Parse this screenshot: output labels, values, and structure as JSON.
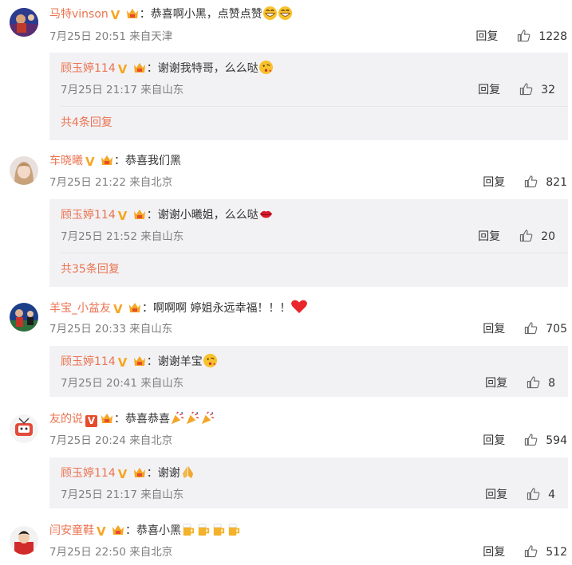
{
  "comments": [
    {
      "user": "马特vinson",
      "badge": "V",
      "text": "：恭喜啊小黑，点赞点赞",
      "meta": "7月25日 20:51 来自天津",
      "reply_label": "回复",
      "likes": "1228",
      "reply": {
        "user": "顾玉婷114",
        "badge": "V",
        "text": "：谢谢我特哥，么么哒",
        "meta": "7月25日 21:17 来自山东",
        "reply_label": "回复",
        "likes": "32",
        "more": "共4条回复"
      }
    },
    {
      "user": "车晓曦",
      "badge": "V",
      "text": "：恭喜我们黑",
      "meta": "7月25日 21:22 来自北京",
      "reply_label": "回复",
      "likes": "821",
      "reply": {
        "user": "顾玉婷114",
        "badge": "V",
        "text": "：谢谢小曦姐，么么哒",
        "meta": "7月25日 21:52 来自山东",
        "reply_label": "回复",
        "likes": "20",
        "more": "共35条回复"
      }
    },
    {
      "user": "羊宝_小盆友",
      "badge": "V",
      "text": "：啊啊啊 婷姐永远幸福！！！",
      "meta": "7月25日 20:33 来自山东",
      "reply_label": "回复",
      "likes": "705",
      "reply": {
        "user": "顾玉婷114",
        "badge": "V",
        "text": "：谢谢羊宝",
        "meta": "7月25日 20:41 来自山东",
        "reply_label": "回复",
        "likes": "8"
      }
    },
    {
      "user": "友的说",
      "badge": "V",
      "text": "：恭喜恭喜",
      "meta": "7月25日 20:24 来自北京",
      "reply_label": "回复",
      "likes": "594",
      "reply": {
        "user": "顾玉婷114",
        "badge": "V",
        "text": "：谢谢",
        "meta": "7月25日 21:17 来自山东",
        "reply_label": "回复",
        "likes": "4"
      }
    },
    {
      "user": "闫安童鞋",
      "badge": "V",
      "text": "：恭喜小黑",
      "meta": "7月25日 22:50 来自北京",
      "reply_label": "回复",
      "likes": "512"
    }
  ],
  "colors": {
    "username": "#eb7350",
    "reply_bg": "#f2f2f5",
    "vip_orange": "#f5a623",
    "vip_red": "#e64c2c"
  }
}
